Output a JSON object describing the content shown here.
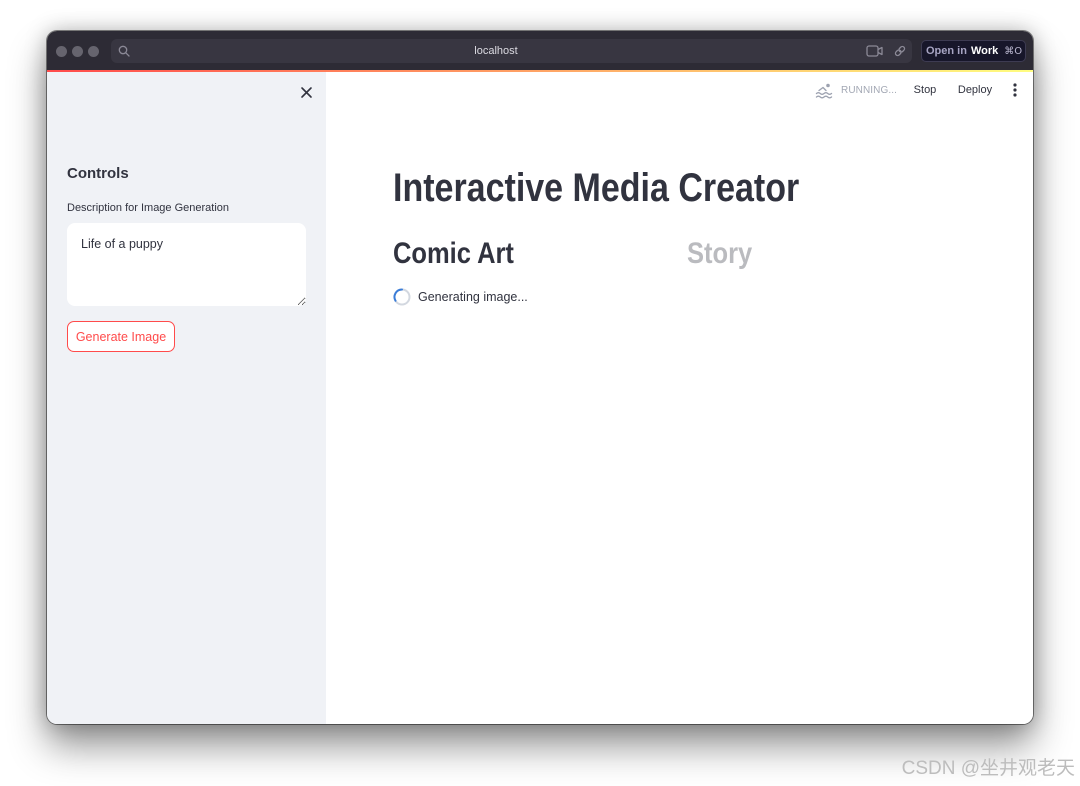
{
  "browser": {
    "url": "localhost",
    "open_in": {
      "prefix": "Open in",
      "target": "Work",
      "shortcut": "⌘O"
    }
  },
  "status": {
    "running_label": "RUNNING...",
    "stop_label": "Stop",
    "deploy_label": "Deploy"
  },
  "sidebar": {
    "title": "Controls",
    "description_label": "Description for Image Generation",
    "description_value": "Life of a puppy",
    "generate_button_label": "Generate Image"
  },
  "main": {
    "title": "Interactive Media Creator",
    "columns": [
      {
        "heading": "Comic Art",
        "spinner_text": "Generating image..."
      },
      {
        "heading": "Story"
      }
    ]
  },
  "watermark": "CSDN @坐井观老天",
  "icons": {
    "address_search": "search-icon",
    "address_capture": "capture-icon",
    "address_copy_link": "link-icon",
    "sidebar_close": "close-icon",
    "status": "running-icon",
    "menu": "more-vertical-icon",
    "loading": "spinner-icon"
  },
  "theme": {
    "primary": "#ff4b4b",
    "text": "#31333f",
    "sidebar_background": "#f0f2f6",
    "titlebar_background": "#2d2b35",
    "decoration_gradient": [
      "#ff4b4b",
      "#fffd80"
    ]
  }
}
